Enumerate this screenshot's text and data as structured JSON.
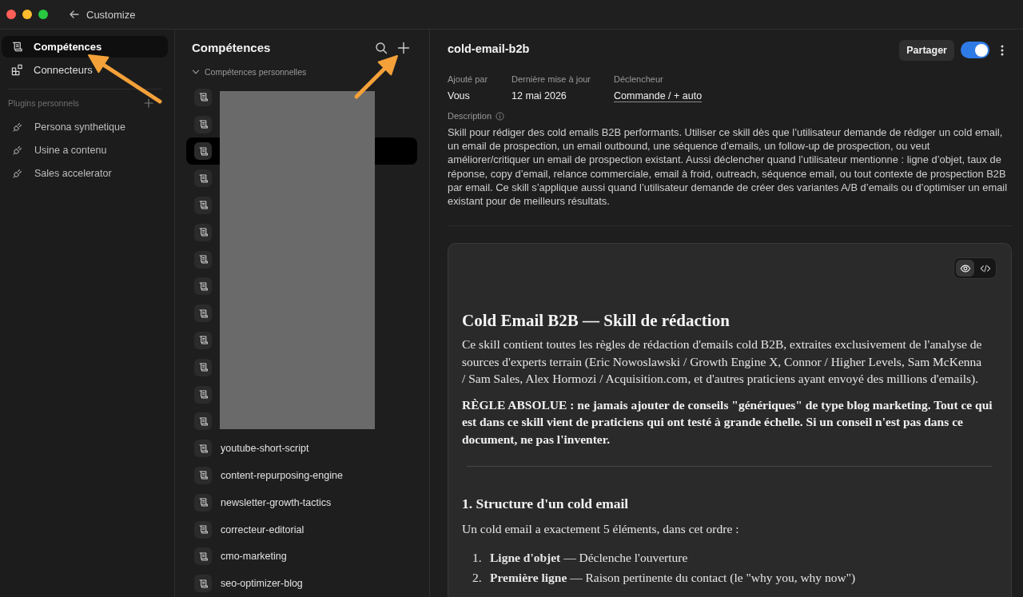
{
  "window": {
    "title": "Customize"
  },
  "sidebar": {
    "nav": [
      {
        "kind": "skills",
        "label": "Compétences",
        "selected": true
      },
      {
        "kind": "connectors",
        "label": "Connecteurs",
        "selected": false
      }
    ],
    "plugins": {
      "title": "Plugins personnels",
      "items": [
        {
          "label": "Persona synthetique"
        },
        {
          "label": "Usine a contenu"
        },
        {
          "label": "Sales accelerator"
        }
      ]
    }
  },
  "skills": {
    "title": "Compétences",
    "group": {
      "label": "Compétences personnelles",
      "expanded": true
    },
    "items": [
      {
        "redacted": true,
        "selected": false
      },
      {
        "redacted": true,
        "selected": false
      },
      {
        "redacted": true,
        "selected": true
      },
      {
        "redacted": true,
        "selected": false
      },
      {
        "redacted": true,
        "selected": false
      },
      {
        "redacted": true,
        "selected": false
      },
      {
        "redacted": true,
        "selected": false
      },
      {
        "redacted": true,
        "selected": false
      },
      {
        "redacted": true,
        "selected": false
      },
      {
        "redacted": true,
        "selected": false
      },
      {
        "redacted": true,
        "selected": false
      },
      {
        "redacted": true,
        "selected": false
      },
      {
        "redacted": true,
        "selected": false
      },
      {
        "label": "youtube-short-script",
        "redacted": false,
        "selected": false
      },
      {
        "label": "content-repurposing-engine",
        "redacted": false,
        "selected": false
      },
      {
        "label": "newsletter-growth-tactics",
        "redacted": false,
        "selected": false
      },
      {
        "label": "correcteur-editorial",
        "redacted": false,
        "selected": false
      },
      {
        "label": "cmo-marketing",
        "redacted": false,
        "selected": false
      },
      {
        "label": "seo-optimizer-blog",
        "redacted": false,
        "selected": false
      }
    ]
  },
  "detail": {
    "title": "cold-email-b2b",
    "share_button": "Partager",
    "enabled": true,
    "meta": [
      {
        "kind": "text",
        "label": "Ajouté par",
        "value": "Vous"
      },
      {
        "kind": "text",
        "label": "Dernière mise à jour",
        "value": "12 mai 2026"
      },
      {
        "kind": "trigger",
        "label": "Déclencheur",
        "value": "Commande / + auto"
      }
    ],
    "description_label": "Description",
    "description": "Skill pour rédiger des cold emails B2B performants. Utiliser ce skill dès que l’utilisateur demande de rédiger un cold email, un email de prospection, un email outbound, une séquence d’emails, un follow-up de prospection, ou veut améliorer/critiquer un email de prospection existant. Aussi déclencher quand l’utilisateur mentionne : ligne d’objet, taux de réponse, copy d’email, relance commerciale, email à froid, outreach, séquence email, ou tout contexte de prospection B2B par email. Ce skill s’applique aussi quand l’utilisateur demande de créer des variantes A/B d’emails ou d’optimiser un email existant pour de meilleurs résultats."
  },
  "document": {
    "view_modes": [
      {
        "kind": "preview",
        "selected": true
      },
      {
        "kind": "code",
        "selected": false
      }
    ],
    "blocks": [
      {
        "kind": "h1",
        "text": "Cold Email B2B — Skill de rédaction"
      },
      {
        "kind": "p",
        "text": "Ce skill contient toutes les règles de rédaction d'emails cold B2B, extraites exclusivement de l'analyse de sources d'experts terrain (Eric Nowoslawski / Growth Engine X, Connor / Higher Levels, Sam McKenna / Sam Sales, Alex Hormozi / Acquisition.com, et d'autres praticiens ayant envoyé des millions d'emails)."
      },
      {
        "kind": "strong",
        "text": "RÈGLE ABSOLUE : ne jamais ajouter de conseils \"génériques\" de type blog marketing. Tout ce qui est dans ce skill vient de praticiens qui ont testé à grande échelle. Si un conseil n'est pas dans ce document, ne pas l'inventer."
      },
      {
        "kind": "rule"
      },
      {
        "kind": "h2",
        "text": "1. Structure d'un cold email"
      },
      {
        "kind": "p",
        "text": "Un cold email a exactement 5 éléments, dans cet ordre :"
      },
      {
        "kind": "ol",
        "items": [
          {
            "number": "1.",
            "text": "**Ligne d'objet** — Déclenche l'ouverture"
          },
          {
            "number": "2.",
            "text": "**Première ligne** — Raison pertinente du contact (le \"why you, why now\")"
          }
        ]
      }
    ]
  },
  "annotations": [
    {
      "kind": "arrow"
    },
    {
      "kind": "arrow"
    }
  ]
}
